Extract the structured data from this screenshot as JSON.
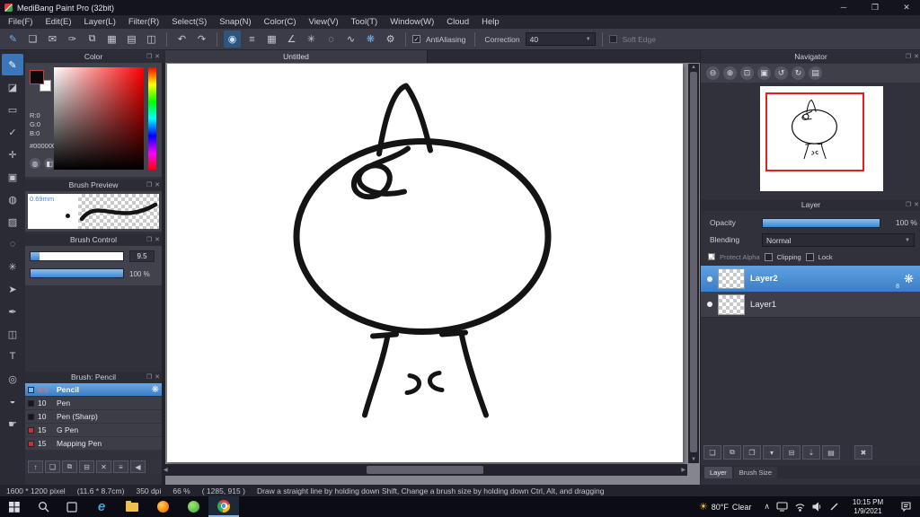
{
  "window": {
    "title": "MediBang Paint Pro (32bit)"
  },
  "menu": {
    "items": [
      "File(F)",
      "Edit(E)",
      "Layer(L)",
      "Filter(R)",
      "Select(S)",
      "Snap(N)",
      "Color(C)",
      "View(V)",
      "Tool(T)",
      "Window(W)",
      "Cloud",
      "Help"
    ]
  },
  "toolbar": {
    "antialiasing": "AntiAliasing",
    "correction": "Correction",
    "correction_value": "40",
    "soft_edge": "Soft Edge"
  },
  "color_panel": {
    "title": "Color",
    "r": "R:0",
    "g": "G:0",
    "b": "B:0",
    "hex": "#000000"
  },
  "brush_preview": {
    "title": "Brush Preview",
    "size": "0.69mm"
  },
  "brush_control": {
    "title": "Brush Control",
    "size_value": "9.5",
    "opacity_value": "100 %"
  },
  "brush_list": {
    "title": "Brush: Pencil",
    "items": [
      {
        "size": "9.5",
        "name": "Pencil",
        "chip": "#7fb2e8",
        "size_color": "#ff6a5a"
      },
      {
        "size": "10",
        "name": "Pen",
        "chip": "#16161e"
      },
      {
        "size": "10",
        "name": "Pen (Sharp)",
        "chip": "#16161e"
      },
      {
        "size": "15",
        "name": "G Pen",
        "chip": "#c03636"
      },
      {
        "size": "15",
        "name": "Mapping Pen",
        "chip": "#c03636"
      }
    ]
  },
  "canvas": {
    "tab": "Untitled"
  },
  "navigator": {
    "title": "Navigator"
  },
  "layer_panel": {
    "title": "Layer",
    "opacity_label": "Opacity",
    "opacity_value": "100 %",
    "blending_label": "Blending",
    "blending_value": "Normal",
    "protect_alpha": "Protect Alpha",
    "clipping": "Clipping",
    "lock": "Lock",
    "layers": [
      {
        "name": "Layer2",
        "badge": "8"
      },
      {
        "name": "Layer1"
      }
    ],
    "tabs": [
      "Layer",
      "Brush Size"
    ]
  },
  "status": {
    "dimensions": "1600 * 1200 pixel",
    "size_cm": "(11.6 * 8.7cm)",
    "dpi": "350 dpi",
    "zoom": "66 %",
    "coords": "( 1285, 915 )",
    "hint": "Draw a straight line by holding down Shift, Change a brush size by holding down Ctrl, Alt, and dragging"
  },
  "taskbar": {
    "weather_temp": "80°F",
    "weather_cond": "Clear",
    "time": "10:15 PM",
    "date": "1/9/2021"
  },
  "colors": {
    "accent": "#4a90d8",
    "viewport_border": "#e02020"
  }
}
